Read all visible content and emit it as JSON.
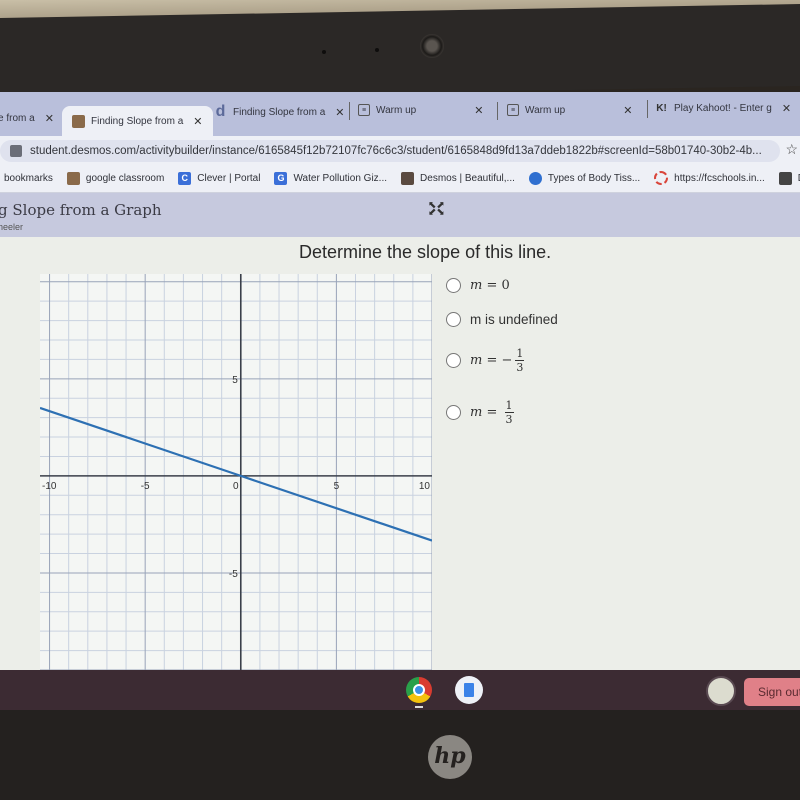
{
  "browser": {
    "tabs": [
      {
        "title": "e from a",
        "icon": "desmos-icon",
        "active": false
      },
      {
        "title": "Finding Slope from a",
        "icon": "classroom-icon",
        "active": true
      },
      {
        "title": "Finding Slope from a",
        "icon": "desmos-d-icon",
        "active": false
      },
      {
        "title": "Warm up",
        "icon": "slides-icon",
        "active": false
      },
      {
        "title": "Warm up",
        "icon": "slides-icon",
        "active": false
      },
      {
        "title": "Play Kahoot! - Enter g",
        "icon": "kahoot-icon",
        "active": false
      }
    ],
    "tab_close": "✕",
    "url": "student.desmos.com/activitybuilder/instance/6165845f12b72107fc76c6c3/student/6165848d9fd13a7ddeb1822b#screenId=58b01740-30b2-4b...",
    "bookmarks": [
      {
        "label": "bookmarks",
        "icon": "",
        "color": ""
      },
      {
        "label": "google classroom",
        "icon": "",
        "color": "#8a6a4a"
      },
      {
        "label": "Clever | Portal",
        "icon": "C",
        "color": "#3b6fd8"
      },
      {
        "label": "Water Pollution Giz...",
        "icon": "G",
        "color": "#3b6fd8"
      },
      {
        "label": "Desmos | Beautiful,...",
        "icon": "",
        "color": "#5a4a40"
      },
      {
        "label": "Types of Body Tiss...",
        "icon": "",
        "color": "#2f6fd0"
      },
      {
        "label": "https://fcschools.in...",
        "icon": "",
        "color": "#d9443a"
      },
      {
        "label": "De",
        "icon": "",
        "color": "#444444"
      }
    ]
  },
  "activity": {
    "title": "g Slope from a Graph",
    "subtitle": "heeler",
    "prompt": "Determine the slope of this line."
  },
  "choices": [
    {
      "type": "math",
      "lhs": "m",
      "op": "=",
      "value": "0"
    },
    {
      "type": "text",
      "label": "m is undefined"
    },
    {
      "type": "fraction",
      "lhs": "m",
      "op": "=",
      "sign": "−",
      "num": "1",
      "den": "3"
    },
    {
      "type": "fraction",
      "lhs": "m",
      "op": "=",
      "sign": "",
      "num": "1",
      "den": "3"
    }
  ],
  "chart_data": {
    "type": "line",
    "title": "",
    "xlabel": "",
    "ylabel": "",
    "xlim": [
      -10.5,
      10
    ],
    "ylim": [
      -10,
      10.4
    ],
    "grid": true,
    "major_step": 5,
    "minor_step": 1,
    "x_ticks": [
      "-10",
      "-5",
      "0",
      "5",
      "10"
    ],
    "y_ticks": [
      "5",
      "-5"
    ],
    "series": [
      {
        "name": "line",
        "color": "#2d70b3",
        "x": [
          -10.5,
          0,
          10
        ],
        "y": [
          3.5,
          0,
          -3.333
        ]
      }
    ]
  },
  "taskbar": {
    "apps": [
      "chrome",
      "docs"
    ],
    "signout_label": "Sign out"
  },
  "device": {
    "logo": "hp"
  }
}
